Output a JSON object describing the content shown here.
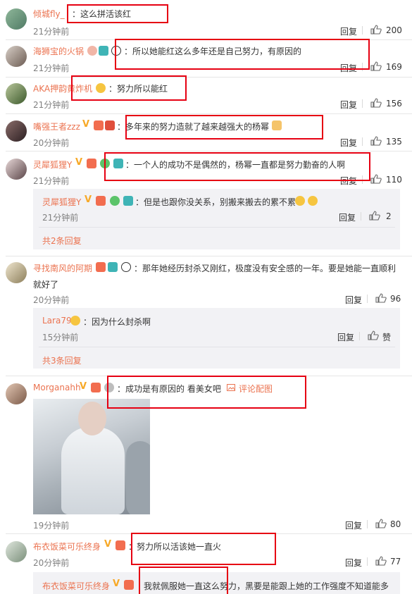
{
  "comments": [
    {
      "name": "倾城fly_",
      "text": "：这么拼活该红",
      "time": "21分钟前",
      "reply": "回复",
      "likes": "200"
    },
    {
      "name": "海狮宝的火锅",
      "text": "：所以她能红这么多年还是自己努力，有原因的",
      "time": "21分钟前",
      "reply": "回复",
      "likes": "169"
    },
    {
      "name": "AKA押韵黄炸机",
      "text": "：努力所以能红",
      "time": "21分钟前",
      "reply": "回复",
      "likes": "156"
    },
    {
      "name": "嘴强王者zzz",
      "text": "：多年来的努力造就了越来越强大的杨幂",
      "time": "20分钟前",
      "reply": "回复",
      "likes": "135"
    },
    {
      "name": "灵犀狐狸Y",
      "text": "：一个人的成功不是偶然的，杨幂一直都是努力勤奋的人啊",
      "time": "21分钟前",
      "reply": "回复",
      "likes": "110"
    },
    {
      "name": "寻找南风的阿期",
      "text": "：那年她经历封杀又刚红，极度没有安全感的一年。要是她能一直顺利",
      "text2": "就好了",
      "time": "20分钟前",
      "reply": "回复",
      "likes": "96"
    },
    {
      "name": "Morganahh",
      "text": "：成功是有原因的 看美女吧",
      "link": "评论配图",
      "time": "19分钟前",
      "reply": "回复",
      "likes": "80"
    },
    {
      "name": "布衣饭菜可乐终身",
      "text": "：努力所以活该她一直火",
      "time": "20分钟前",
      "reply": "回复",
      "likes": "77"
    }
  ],
  "replies": [
    {
      "name": "灵犀狐狸Y",
      "text": "：但是也跟你没关系，别搬来搬去的累不累",
      "time": "21分钟前",
      "reply": "回复",
      "likes": "2",
      "more": "共2条回复"
    },
    {
      "name": "Lara79",
      "text": "：因为什么封杀啊",
      "time": "15分钟前",
      "reply": "回复",
      "likes": "赞",
      "more": "共3条回复"
    },
    {
      "name": "布衣饭菜可乐终身",
      "text": "我就佩服她一直这么努力，黑要是能跟上她的工作强度不知道能多"
    }
  ],
  "colors": {
    "name": "#eb7350",
    "highlight_box": "#e60012",
    "sub_bg": "#f2f2f5"
  },
  "icons": [
    "thumb-up-icon",
    "vip-icon",
    "badge-icon",
    "emoji-icon",
    "image-link-icon"
  ]
}
